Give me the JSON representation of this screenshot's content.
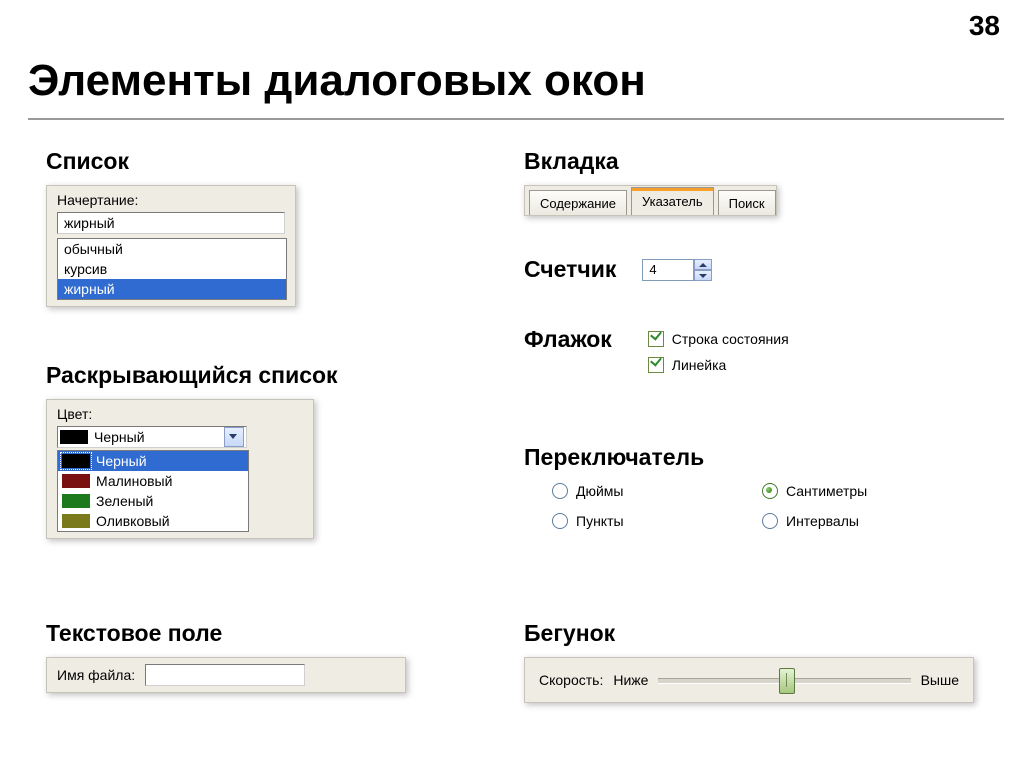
{
  "page_number": "38",
  "title": "Элементы диалоговых окон",
  "sections": {
    "list": "Список",
    "dropdown": "Раскрывающийся список",
    "textfield": "Текстовое поле",
    "tabs": "Вкладка",
    "counter": "Счетчик",
    "checkbox": "Флажок",
    "radio": "Переключатель",
    "slider": "Бегунок"
  },
  "list": {
    "label": "Начертание:",
    "value": "жирный",
    "items": [
      "обычный",
      "курсив",
      "жирный"
    ]
  },
  "dropdown": {
    "label": "Цвет:",
    "value": "Черный",
    "items": [
      {
        "name": "Черный",
        "color": "#000000"
      },
      {
        "name": "Малиновый",
        "color": "#7a1010"
      },
      {
        "name": "Зеленый",
        "color": "#1c7a1c"
      },
      {
        "name": "Оливковый",
        "color": "#7a7a1c"
      }
    ]
  },
  "textfield": {
    "label": "Имя файла:",
    "value": ""
  },
  "tabs": {
    "items": [
      "Содержание",
      "Указатель",
      "Поиск"
    ],
    "active": 1
  },
  "counter": {
    "value": "4"
  },
  "checkboxes": [
    {
      "label": "Строка состояния",
      "checked": true
    },
    {
      "label": "Линейка",
      "checked": true
    }
  ],
  "radios": [
    {
      "label": "Дюймы",
      "checked": false
    },
    {
      "label": "Сантиметры",
      "checked": true
    },
    {
      "label": "Пункты",
      "checked": false
    },
    {
      "label": "Интервалы",
      "checked": false
    }
  ],
  "slider": {
    "label": "Скорость:",
    "low": "Ниже",
    "high": "Выше"
  }
}
